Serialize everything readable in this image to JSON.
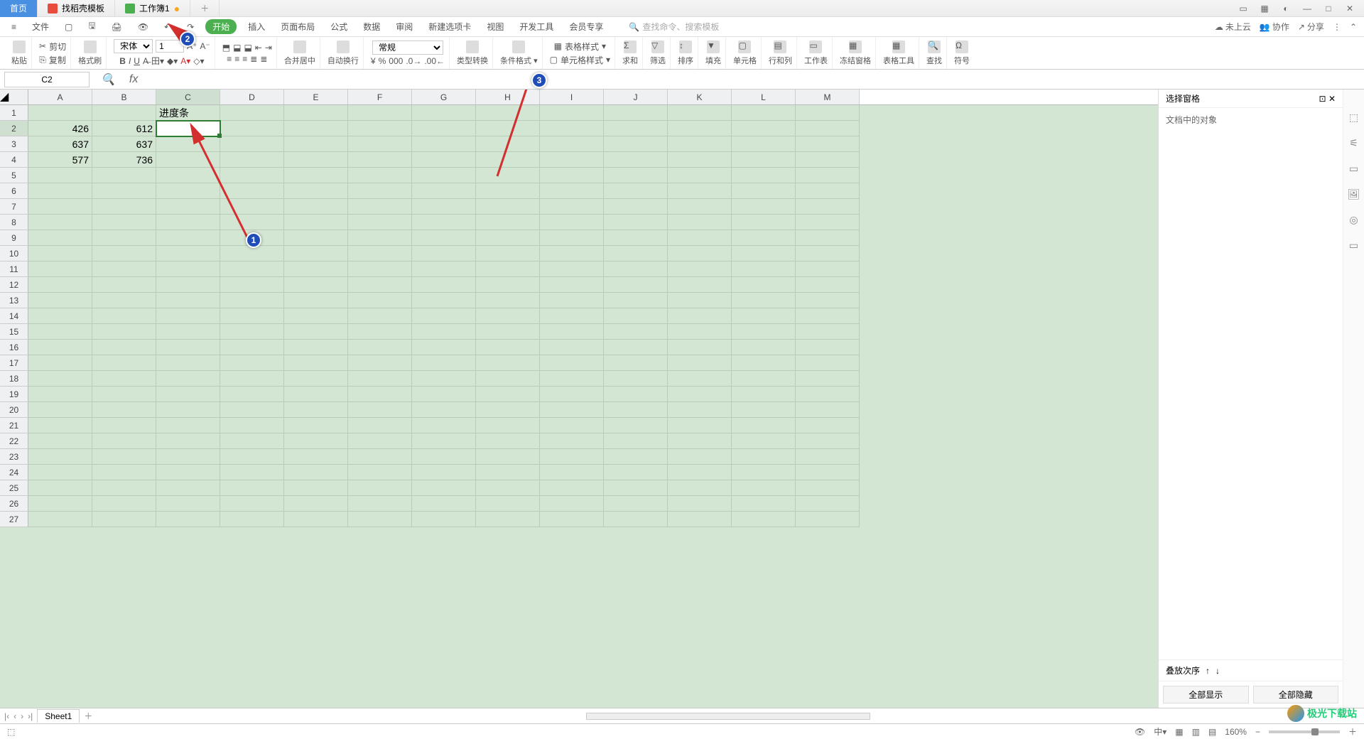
{
  "titlebar": {
    "home": "首页",
    "tab1": "找稻壳模板",
    "tab2": "工作簿1"
  },
  "menubar": {
    "file": "文件",
    "start": "开始",
    "insert": "插入",
    "layout": "页面布局",
    "formula": "公式",
    "data": "数据",
    "review": "审阅",
    "newtab": "新建选项卡",
    "view": "视图",
    "devtools": "开发工具",
    "member": "会员专享",
    "search_placeholder": "查找命令、搜索模板",
    "cloud": "未上云",
    "coop": "协作",
    "share": "分享"
  },
  "ribbon": {
    "paste": "粘贴",
    "cut": "剪切",
    "copy": "复制",
    "format_painter": "格式刷",
    "font_name": "宋体",
    "font_size": "1",
    "merge": "合并居中",
    "wrap": "自动换行",
    "numfmt": "常规",
    "type_convert": "类型转换",
    "cond_format": "条件格式",
    "table_style": "表格样式",
    "cell_style": "单元格样式",
    "sum": "求和",
    "filter": "筛选",
    "sort": "排序",
    "fill": "填充",
    "cell": "单元格",
    "rowcol": "行和列",
    "sheet": "工作表",
    "freeze": "冻结窗格",
    "table_tools": "表格工具",
    "find": "查找",
    "symbol": "符号"
  },
  "refbar": {
    "cell": "C2",
    "fx": "fx"
  },
  "columns": [
    "A",
    "B",
    "C",
    "D",
    "E",
    "F",
    "G",
    "H",
    "I",
    "J",
    "K",
    "L",
    "M"
  ],
  "rows": [
    1,
    2,
    3,
    4,
    5,
    6,
    7,
    8,
    9,
    10,
    11,
    12,
    13,
    14,
    15,
    16,
    17,
    18,
    19,
    20,
    21,
    22,
    23,
    24,
    25,
    26,
    27
  ],
  "cells": {
    "C1": "进度条",
    "A2": "426",
    "B2": "612",
    "A3": "637",
    "B3": "637",
    "A4": "577",
    "B4": "736"
  },
  "side": {
    "title": "选择窗格",
    "doc_objects": "文档中的对象",
    "stack_order": "叠放次序",
    "show_all": "全部显示",
    "hide_all": "全部隐藏"
  },
  "sheet": {
    "name": "Sheet1"
  },
  "status": {
    "zoom": "160%"
  },
  "annotations": {
    "c1": "1",
    "c2": "2",
    "c3": "3"
  },
  "watermark": "极光下载站"
}
